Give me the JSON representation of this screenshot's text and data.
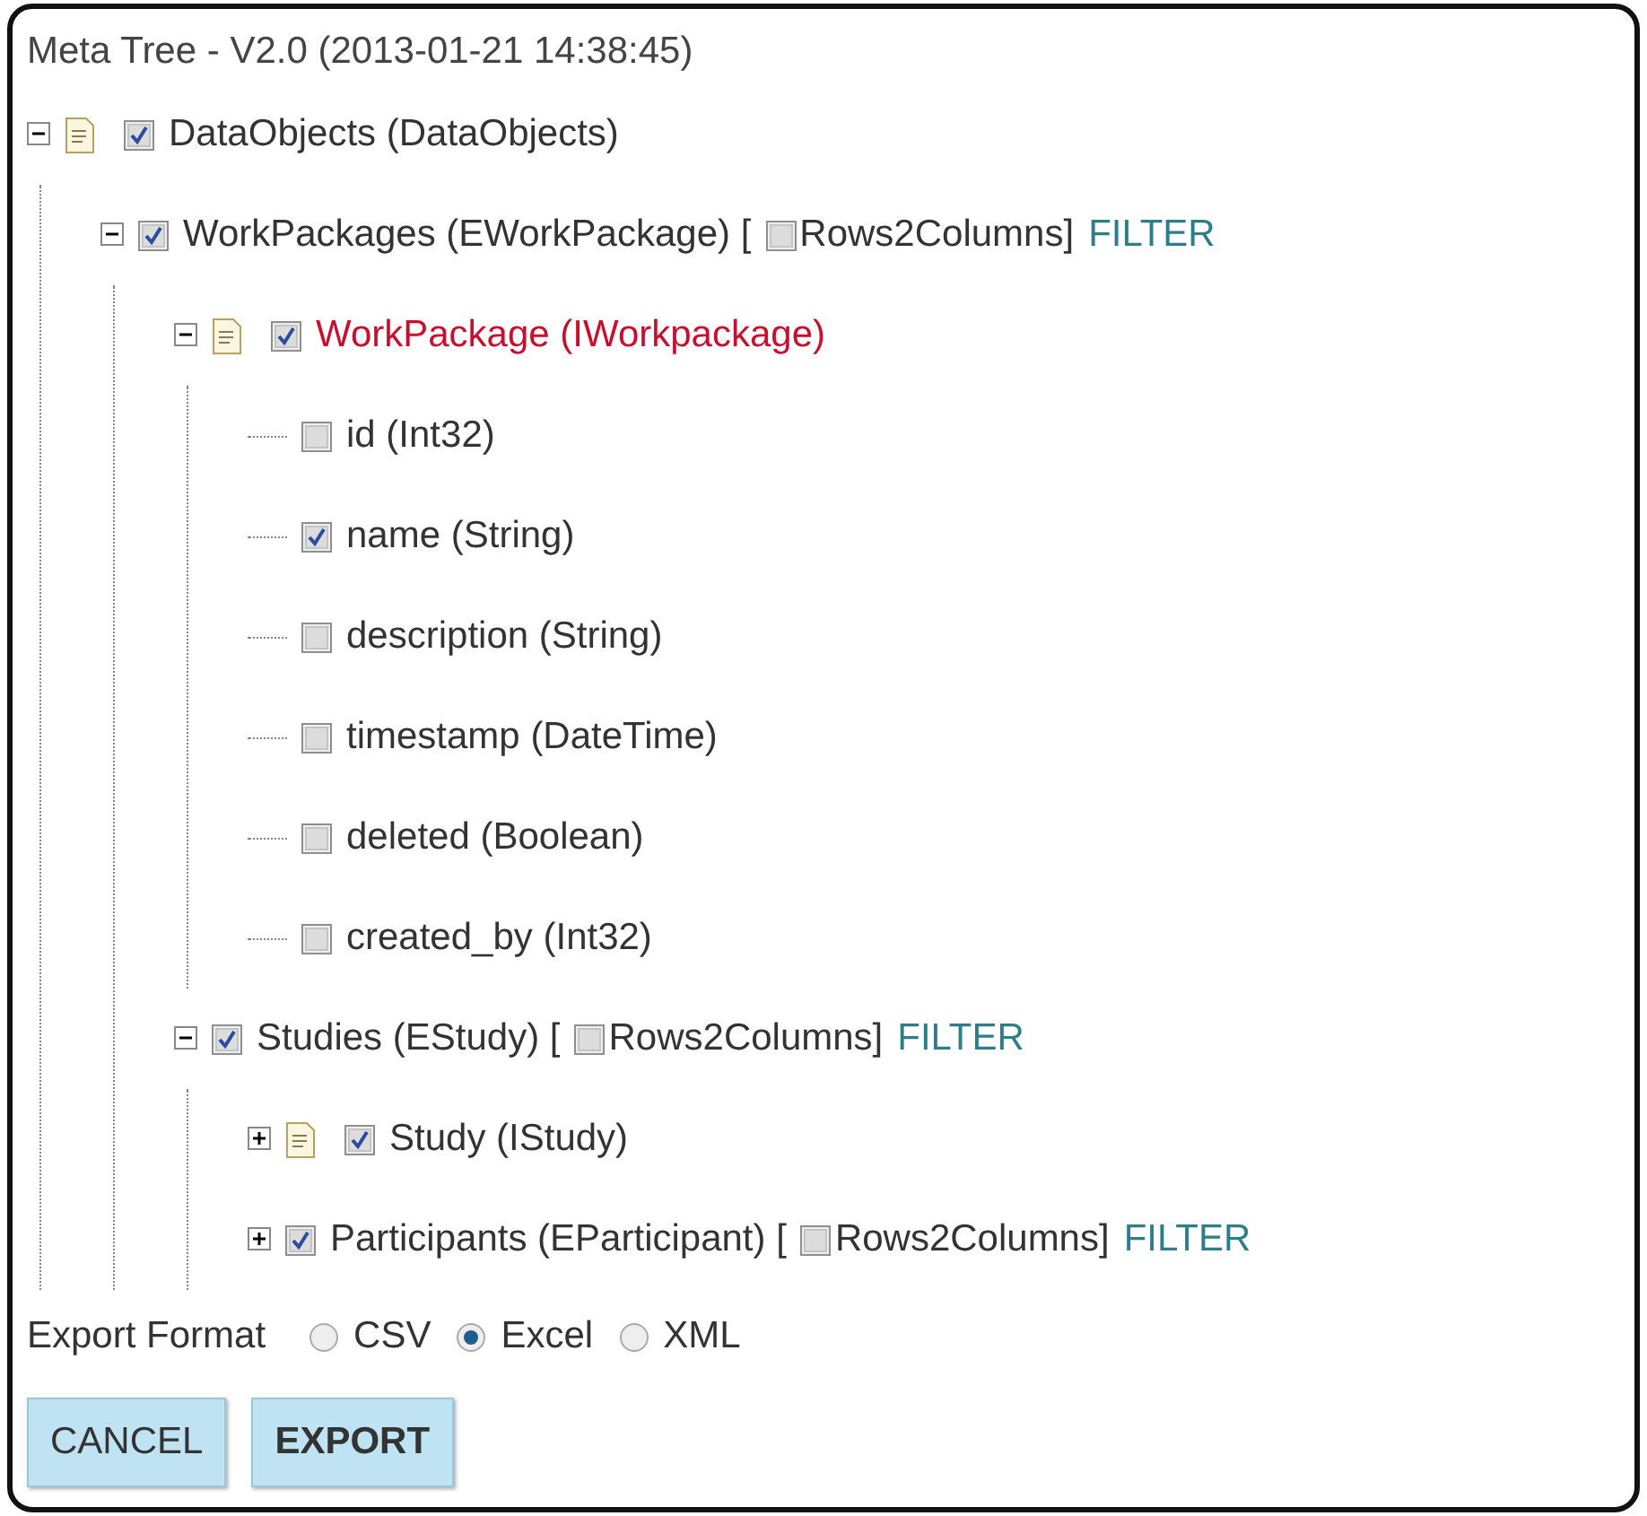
{
  "title": "Meta Tree - V2.0 (2013-01-21 14:38:45)",
  "tree": [
    {
      "kind": "object",
      "label": "DataObjects (DataObjects)",
      "checked": true,
      "expanded": true,
      "children": [
        {
          "kind": "collection",
          "label": "WorkPackages (EWorkPackage) [",
          "checked": true,
          "expanded": true,
          "option": {
            "label": "Rows2Columns]",
            "checked": false
          },
          "link": "FILTER",
          "children": [
            {
              "kind": "object",
              "label": "WorkPackage (IWorkpackage)",
              "checked": true,
              "expanded": true,
              "highlighted": true,
              "children": [
                {
                  "kind": "field",
                  "label": "id (Int32)",
                  "checked": false
                },
                {
                  "kind": "field",
                  "label": "name (String)",
                  "checked": true
                },
                {
                  "kind": "field",
                  "label": "description (String)",
                  "checked": false
                },
                {
                  "kind": "field",
                  "label": "timestamp (DateTime)",
                  "checked": false
                },
                {
                  "kind": "field",
                  "label": "deleted (Boolean)",
                  "checked": false
                },
                {
                  "kind": "field",
                  "label": "created_by (Int32)",
                  "checked": false
                }
              ]
            },
            {
              "kind": "collection",
              "label": "Studies (EStudy) [",
              "checked": true,
              "expanded": true,
              "option": {
                "label": "Rows2Columns]",
                "checked": false
              },
              "link": "FILTER",
              "children": [
                {
                  "kind": "object",
                  "label": "Study (IStudy)",
                  "checked": true,
                  "expanded": false
                },
                {
                  "kind": "collection",
                  "label": "Participants (EParticipant) [",
                  "checked": true,
                  "expanded": false,
                  "option": {
                    "label": "Rows2Columns]",
                    "checked": false
                  },
                  "link": "FILTER"
                }
              ]
            }
          ]
        }
      ]
    }
  ],
  "export": {
    "label": "Export Format",
    "options": [
      {
        "label": "CSV",
        "selected": false
      },
      {
        "label": "Excel",
        "selected": true
      },
      {
        "label": "XML",
        "selected": false
      }
    ]
  },
  "buttons": [
    {
      "label": "CANCEL",
      "primary": false
    },
    {
      "label": "EXPORT",
      "primary": true
    }
  ]
}
